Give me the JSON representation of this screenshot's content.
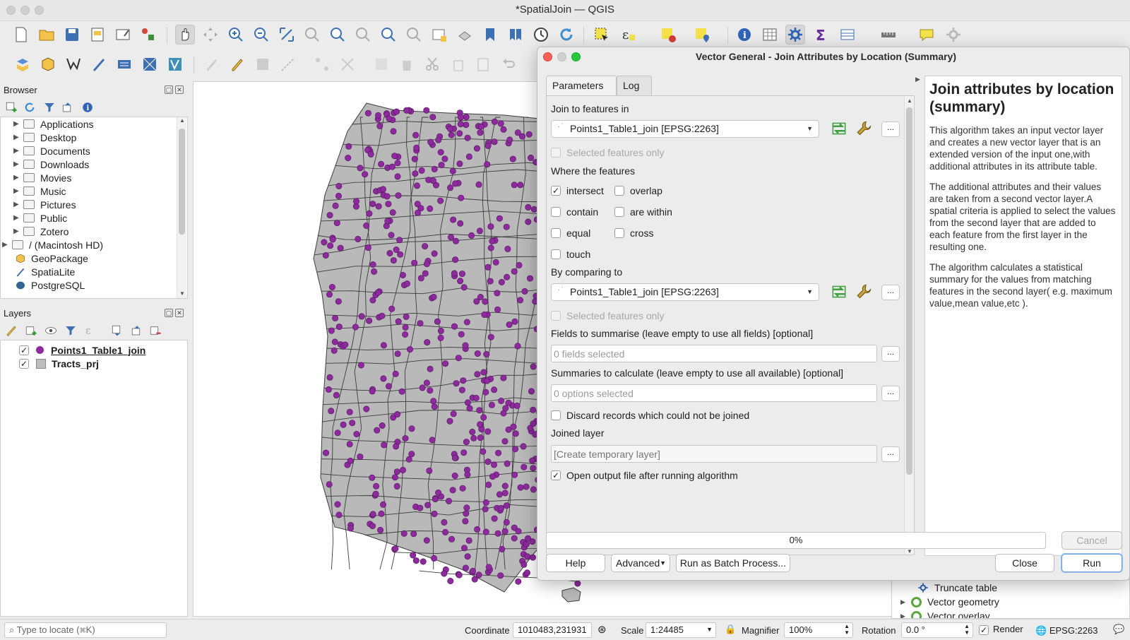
{
  "window": {
    "title": "*SpatialJoin — QGIS"
  },
  "browser": {
    "title": "Browser",
    "items": [
      {
        "label": "Applications",
        "icon": "folder-icon"
      },
      {
        "label": "Desktop",
        "icon": "folder-icon"
      },
      {
        "label": "Documents",
        "icon": "folder-icon"
      },
      {
        "label": "Downloads",
        "icon": "folder-icon"
      },
      {
        "label": "Movies",
        "icon": "folder-icon"
      },
      {
        "label": "Music",
        "icon": "folder-icon"
      },
      {
        "label": "Pictures",
        "icon": "folder-icon"
      },
      {
        "label": "Public",
        "icon": "folder-icon"
      },
      {
        "label": "Zotero",
        "icon": "folder-icon"
      },
      {
        "label": "/ (Macintosh HD)",
        "icon": "folder-icon"
      },
      {
        "label": "GeoPackage",
        "icon": "geopackage-icon"
      },
      {
        "label": "SpatiaLite",
        "icon": "spatialite-icon"
      },
      {
        "label": "PostgreSQL",
        "icon": "postgresql-icon"
      }
    ]
  },
  "layers": {
    "title": "Layers",
    "items": [
      {
        "label": "Points1_Table1_join",
        "checked": true,
        "symbol_color": "#8e2a9e"
      },
      {
        "label": "Tracts_prj",
        "checked": true,
        "symbol_color": "#bdbdbd"
      }
    ]
  },
  "dialog": {
    "title": "Vector General - Join Attributes by Location (Summary)",
    "tabs": [
      "Parameters",
      "Log"
    ],
    "join_label": "Join to features in",
    "join_layer": "Points1_Table1_join [EPSG:2263]",
    "selected_only": "Selected features only",
    "where_label": "Where the features",
    "predicates": {
      "intersect": "intersect",
      "overlap": "overlap",
      "contain": "contain",
      "within": "are within",
      "equal": "equal",
      "cross": "cross",
      "touch": "touch"
    },
    "compare_label": "By comparing to",
    "compare_layer": "Points1_Table1_join [EPSG:2263]",
    "fields_label": "Fields to summarise (leave empty to use all fields) [optional]",
    "fields_placeholder": "0 fields selected",
    "summaries_label": "Summaries to calculate (leave empty to use all available) [optional]",
    "summaries_placeholder": "0 options selected",
    "discard_label": "Discard records which could not be joined",
    "joined_label": "Joined layer",
    "joined_placeholder": "[Create temporary layer]",
    "open_output_label": "Open output file after running algorithm",
    "ellipsis": "...",
    "progress": "0%",
    "buttons": {
      "cancel": "Cancel",
      "help": "Help",
      "advanced": "Advanced",
      "batch": "Run as Batch Process...",
      "close": "Close",
      "run": "Run"
    },
    "help": {
      "title": "Join attributes by location (summary)",
      "p1": "This algorithm takes an input vector layer and creates a new vector layer that is an extended version of the input one,with additional attributes in its attribute table.",
      "p2": "The additional attributes and their values are taken from a second vector layer.A spatial criteria is applied to select the values from the second layer that are added to each feature from the first layer in the resulting one.",
      "p3": "The algorithm calculates a statistical summary for the values from matching features in the second layer( e.g. maximum value,mean value,etc )."
    }
  },
  "toolbox": {
    "items": [
      "Truncate table",
      "Vector geometry",
      "Vector overlay"
    ]
  },
  "status": {
    "locate_placeholder": "Type to locate (⌘K)",
    "coordinate_label": "Coordinate",
    "coordinate": "1010483,231931",
    "scale_label": "Scale",
    "scale": "1:24485",
    "magnifier_label": "Magnifier",
    "magnifier": "100%",
    "rotation_label": "Rotation",
    "rotation": "0.0 °",
    "render_label": "Render",
    "crs": "EPSG:2263"
  },
  "colors": {
    "point": "#8e2a9e",
    "polygon": "#b9b9b9",
    "accent": "#2f6fd0"
  }
}
